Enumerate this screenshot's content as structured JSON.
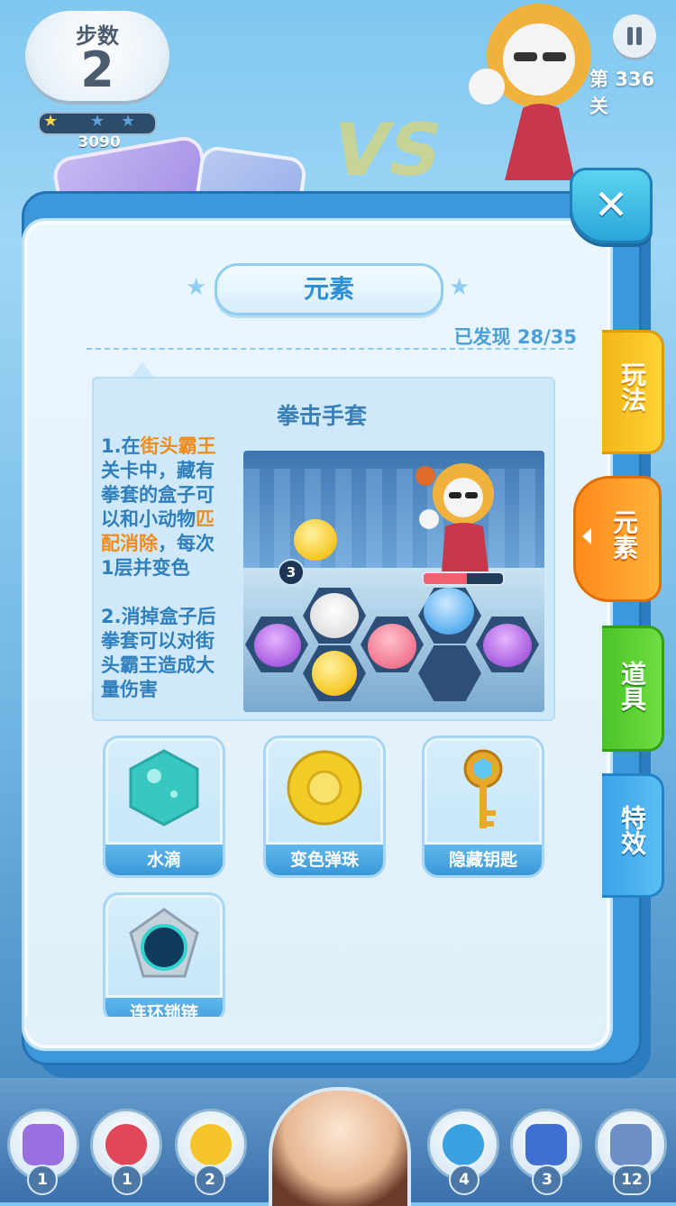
{
  "hud": {
    "steps_label": "步数",
    "steps_value": "2",
    "score": "3090",
    "level": "第 336 关"
  },
  "book": {
    "close_icon": "close-icon",
    "title": "元素",
    "found": "已发现 28/35"
  },
  "detail": {
    "title": "拳击手套",
    "desc_lines": [
      {
        "parts": [
          {
            "t": "1.在",
            "hl": false
          },
          {
            "t": "街头霸王",
            "hl": true
          }
        ]
      },
      {
        "parts": [
          {
            "t": "关卡中，藏有",
            "hl": false
          }
        ]
      },
      {
        "parts": [
          {
            "t": "拳套的盒子可",
            "hl": false
          }
        ]
      },
      {
        "parts": [
          {
            "t": "以和小动物",
            "hl": false
          },
          {
            "t": "匹",
            "hl": true
          }
        ]
      },
      {
        "parts": [
          {
            "t": "配消除",
            "hl": true
          },
          {
            "t": "，每次",
            "hl": false
          }
        ]
      },
      {
        "parts": [
          {
            "t": "1层并变色",
            "hl": false
          }
        ]
      },
      {
        "parts": []
      },
      {
        "parts": [
          {
            "t": "2.消掉盒子后",
            "hl": false
          }
        ]
      },
      {
        "parts": [
          {
            "t": "拳套可以对街",
            "hl": false
          }
        ]
      },
      {
        "parts": [
          {
            "t": "头霸王造成大",
            "hl": false
          }
        ]
      },
      {
        "parts": [
          {
            "t": "量伤害",
            "hl": false
          }
        ]
      }
    ],
    "preview_badge": "3",
    "boss_hp_fraction": 0.55
  },
  "elements": [
    {
      "label": "水滴",
      "icon": "water-drop-icon"
    },
    {
      "label": "变色弹珠",
      "icon": "color-marble-icon"
    },
    {
      "label": "隐藏钥匙",
      "icon": "hidden-key-icon"
    },
    {
      "label": "连环锁链",
      "icon": "chain-lock-icon"
    }
  ],
  "tabs": {
    "play": "玩法",
    "elements": "元素",
    "props": "道具",
    "effects": "特效"
  },
  "tools": [
    {
      "count": "1",
      "icon": "hammer-icon"
    },
    {
      "count": "1",
      "icon": "rocket-icon"
    },
    {
      "count": "2",
      "icon": "balloon-icon"
    },
    {
      "count": "4",
      "icon": "swap-icon"
    },
    {
      "count": "3",
      "icon": "dice-icon"
    },
    {
      "count": "12",
      "icon": "hourglass-icon"
    }
  ],
  "colors": {
    "highlight": "#f08c1a",
    "text_blue": "#2f7fbd",
    "tab_play": "#ffd233",
    "tab_elements": "#ff8a1c",
    "tab_props": "#4bc42a",
    "tab_effects": "#3aa4e8"
  }
}
